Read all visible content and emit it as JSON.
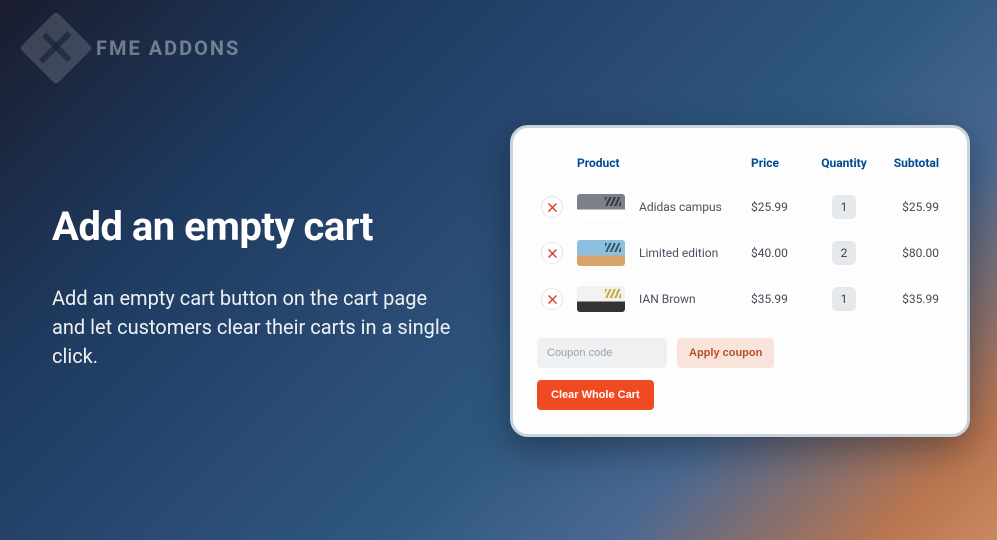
{
  "brand": {
    "name": "FME ADDONS"
  },
  "hero": {
    "heading": "Add an empty cart",
    "subtext": "Add an empty cart button on the cart page and let customers clear their carts in a single click."
  },
  "cart": {
    "headers": {
      "product": "Product",
      "price": "Price",
      "quantity": "Quantity",
      "subtotal": "Subtotal"
    },
    "items": [
      {
        "name": "Adidas campus",
        "price": "$25.99",
        "qty": "1",
        "subtotal": "$25.99",
        "variant": "gray"
      },
      {
        "name": "Limited edition",
        "price": "$40.00",
        "qty": "2",
        "subtotal": "$80.00",
        "variant": "blue"
      },
      {
        "name": "IAN Brown",
        "price": "$35.99",
        "qty": "1",
        "subtotal": "$35.99",
        "variant": "white"
      }
    ],
    "coupon_placeholder": "Coupon code",
    "apply_label": "Apply coupon",
    "clear_label": "Clear Whole Cart"
  }
}
